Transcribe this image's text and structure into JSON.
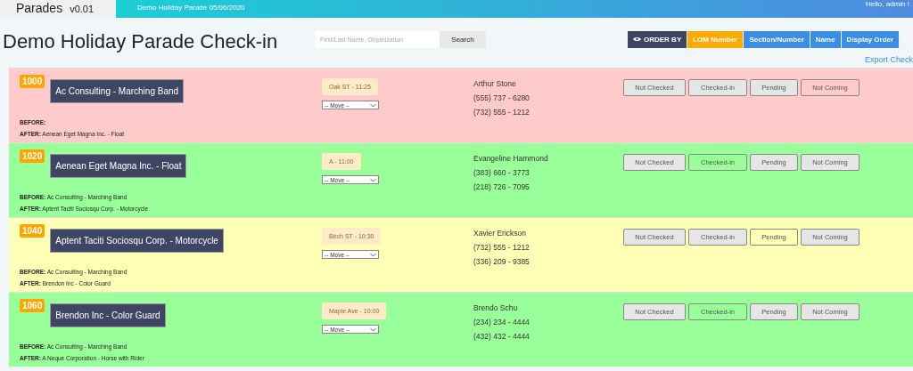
{
  "app": {
    "name": "Parades",
    "version": "v0.01",
    "event": "Demo Holiday Parade 05/06/2020",
    "greeting": "Hello, admin !"
  },
  "page": {
    "title": "Demo Holiday Parade Check-in",
    "search": {
      "placeholder": "First/Last Name, Organization",
      "button": "Search"
    },
    "order_by": {
      "label": "ORDER BY",
      "options": [
        {
          "label": "LOM Number",
          "selected": true
        },
        {
          "label": "Section/Number",
          "selected": false
        },
        {
          "label": "Name",
          "selected": false
        },
        {
          "label": "Display Order",
          "selected": false
        }
      ]
    },
    "export_link": "Export Check"
  },
  "entries": [
    {
      "number": "1000",
      "name": "Ac Consulting - Marching Band",
      "before_label": "BEFORE:",
      "after_label": "AFTER:",
      "after": "Aenean Eget Magna Inc. - Float",
      "slot": "Oak ST - 11:25",
      "move": "-- Move --",
      "contact": "Arthur Stone",
      "phones": [
        "(555) 737 - 6280",
        "(732) 555 - 1212"
      ],
      "kind": "not_coming",
      "buttons": [
        {
          "label": "Not Checked",
          "selected": false
        },
        {
          "label": "Checked-in",
          "selected": false
        },
        {
          "label": "Pending",
          "selected": false
        },
        {
          "label": "Not Coming",
          "selected": true
        }
      ]
    },
    {
      "number": "1020",
      "name": "Aenean Eget Magna Inc. - Float",
      "before_label": "BEFORE:",
      "before": "Ac Consulting - Marching Band",
      "after_label": "AFTER:",
      "after": "Aptent Taciti Sociosqu Corp. - Motorcycle",
      "slot": "A - 11:00",
      "move": "-- Move --",
      "contact": "Evangeline Hammond",
      "phones": [
        "(383) 660 - 3773",
        "(218) 726 - 7095"
      ],
      "kind": "checked_in",
      "buttons": [
        {
          "label": "Not Checked",
          "selected": false
        },
        {
          "label": "Checked-in",
          "selected": true
        },
        {
          "label": "Pending",
          "selected": false
        },
        {
          "label": "Not Coming",
          "selected": false
        }
      ]
    },
    {
      "number": "1040",
      "name": "Aptent Taciti Sociosqu Corp. - Motorcycle",
      "before_label": "BEFORE:",
      "before": "Ac Consulting - Marching Band",
      "after_label": "AFTER:",
      "after": "Brendon Inc - Color Guard",
      "slot": "Birch ST - 10:30",
      "move": "-- Move --",
      "contact": "Xavier Erickson",
      "phones": [
        "(732) 555 - 1212",
        "(336) 209 - 9385"
      ],
      "kind": "pending",
      "buttons": [
        {
          "label": "Not Checked",
          "selected": false
        },
        {
          "label": "Checked-in",
          "selected": false
        },
        {
          "label": "Pending",
          "selected": true
        },
        {
          "label": "Not Coming",
          "selected": false
        }
      ]
    },
    {
      "number": "1060",
      "name": "Brendon Inc - Color Guard",
      "before_label": "BEFORE:",
      "before": "Ac Consulting - Marching Band",
      "after_label": "AFTER:",
      "after": "A Neque Corporation - Horse with Rider",
      "slot": "Maple Ave - 10:00",
      "move": "-- Move --",
      "contact": "Brendo Schu",
      "phones": [
        "(234) 234 - 4444",
        "(432) 432 - 4444"
      ],
      "kind": "checked_in",
      "buttons": [
        {
          "label": "Not Checked",
          "selected": false
        },
        {
          "label": "Checked-in",
          "selected": true
        },
        {
          "label": "Pending",
          "selected": false
        },
        {
          "label": "Not Coming",
          "selected": false
        }
      ]
    }
  ]
}
